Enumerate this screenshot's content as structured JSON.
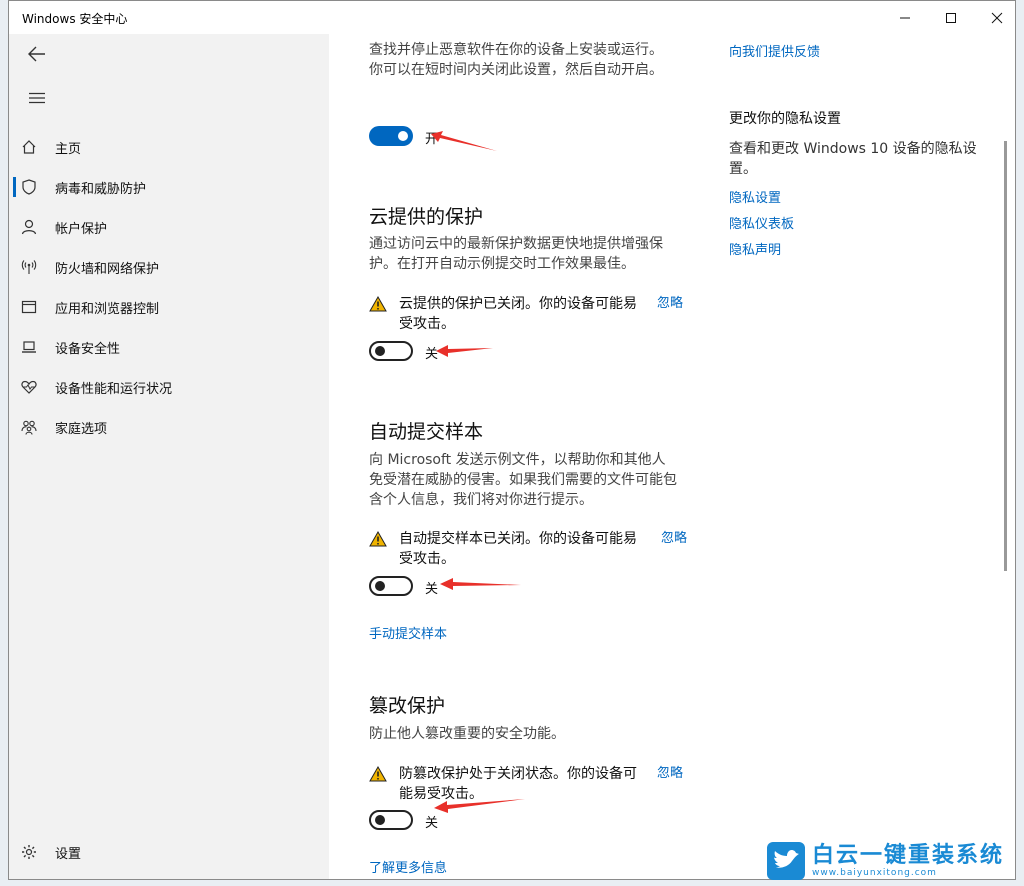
{
  "window": {
    "title": "Windows 安全中心"
  },
  "sidebar": {
    "items": [
      {
        "label": "主页",
        "icon": "home-icon"
      },
      {
        "label": "病毒和威胁防护",
        "icon": "shield-icon",
        "active": true
      },
      {
        "label": "帐户保护",
        "icon": "person-icon"
      },
      {
        "label": "防火墙和网络保护",
        "icon": "wifi-antenna-icon"
      },
      {
        "label": "应用和浏览器控制",
        "icon": "app-window-icon"
      },
      {
        "label": "设备安全性",
        "icon": "laptop-icon"
      },
      {
        "label": "设备性能和运行状况",
        "icon": "heart-pulse-icon"
      },
      {
        "label": "家庭选项",
        "icon": "family-icon"
      }
    ],
    "settings_label": "设置"
  },
  "main": {
    "realtime": {
      "desc": "查找并停止恶意软件在你的设备上安装或运行。 你可以在短时间内关闭此设置，然后自动开启。",
      "toggle_label": "开",
      "toggle_on": true
    },
    "cloud": {
      "title": "云提供的保护",
      "desc": "通过访问云中的最新保护数据更快地提供增强保护。在打开自动示例提交时工作效果最佳。",
      "warning": "云提供的保护已关闭。你的设备可能易受攻击。",
      "dismiss": "忽略",
      "toggle_label": "关",
      "toggle_on": false
    },
    "sample": {
      "title": "自动提交样本",
      "desc": "向 Microsoft 发送示例文件，以帮助你和其他人免受潜在威胁的侵害。如果我们需要的文件可能包含个人信息，我们将对你进行提示。",
      "warning": "自动提交样本已关闭。你的设备可能易受攻击。",
      "dismiss": "忽略",
      "toggle_label": "关",
      "toggle_on": false,
      "manual_link": "手动提交样本"
    },
    "tamper": {
      "title": "篡改保护",
      "desc": "防止他人篡改重要的安全功能。",
      "warning": "防篡改保护处于关闭状态。你的设备可能易受攻击。",
      "dismiss": "忽略",
      "toggle_label": "关",
      "toggle_on": false,
      "learn_more": "了解更多信息"
    }
  },
  "aside": {
    "feedback_link": "向我们提供反馈",
    "privacy_title": "更改你的隐私设置",
    "privacy_desc": "查看和更改 Windows 10 设备的隐私设置。",
    "links": [
      "隐私设置",
      "隐私仪表板",
      "隐私声明"
    ]
  },
  "watermark": {
    "title": "白云一键重装系统",
    "url": "www.baiyunxitong.com"
  },
  "colors": {
    "accent": "#0067c0",
    "warning": "#f0b400",
    "annotation_arrow": "#e8302a"
  }
}
